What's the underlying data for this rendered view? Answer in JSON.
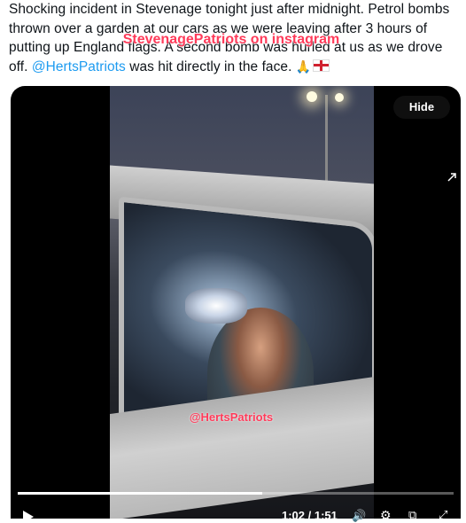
{
  "tweet": {
    "text": "Shocking incident in Stevenage tonight just after midnight. Petrol bombs thrown over a garden at our cars as we were leaving after 3 hours of putting up England flags. A second bomb was hurled at us as we drove off. ",
    "mention": "@HertsPatriots",
    "text_after": " was hit directly in the face. "
  },
  "media": {
    "watermark_top": "StevenagePatriots on instagram",
    "watermark_bottom": "@HertsPatriots",
    "hide_label": "Hide",
    "progress_fraction": 0.56
  },
  "controls": {
    "time": "1:02 / 1:51",
    "icons": [
      "play-icon",
      "volume-icon",
      "gear-icon",
      "pip-icon",
      "fullscreen-icon"
    ]
  }
}
